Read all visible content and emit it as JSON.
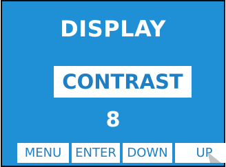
{
  "screen": {
    "title": "DISPLAY",
    "setting_label": "CONTRAST",
    "value": "8",
    "softkeys": {
      "menu": "MENU",
      "enter": "ENTER",
      "down": "DOWN",
      "up": "UP"
    }
  },
  "colors": {
    "background": "#1f8fd6",
    "accent_text": "#1f7fc4",
    "text": "#ffffff"
  }
}
